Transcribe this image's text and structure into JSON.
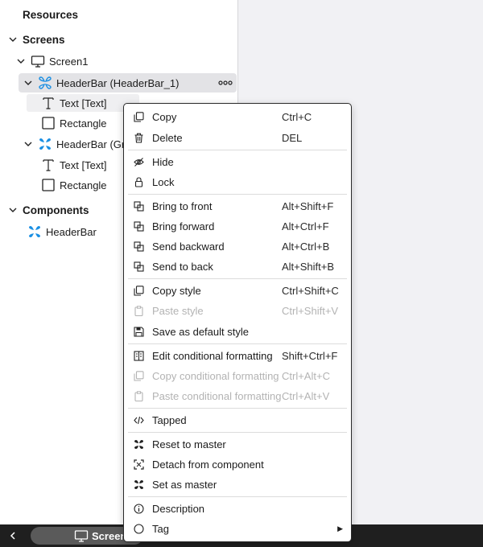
{
  "tree": {
    "resources_label": "Resources",
    "screens_label": "Screens",
    "screen1_label": "Screen1",
    "headerbar1_label": "HeaderBar (HeaderBar_1)",
    "text1_label": "Text [Text]",
    "rect1_label": "Rectangle",
    "headerbar2_label": "HeaderBar (Gre",
    "text2_label": "Text [Text]",
    "rect2_label": "Rectangle",
    "components_label": "Components",
    "component_headerbar_label": "HeaderBar"
  },
  "bottom_bar": {
    "screen_tab_label": "Screen"
  },
  "context_menu": {
    "copy": {
      "label": "Copy",
      "shortcut": "Ctrl+C"
    },
    "delete": {
      "label": "Delete",
      "shortcut": "DEL"
    },
    "hide": {
      "label": "Hide"
    },
    "lock": {
      "label": "Lock"
    },
    "bring_to_front": {
      "label": "Bring to front",
      "shortcut": "Alt+Shift+F"
    },
    "bring_forward": {
      "label": "Bring forward",
      "shortcut": "Alt+Ctrl+F"
    },
    "send_backward": {
      "label": "Send backward",
      "shortcut": "Alt+Ctrl+B"
    },
    "send_to_back": {
      "label": "Send to back",
      "shortcut": "Alt+Shift+B"
    },
    "copy_style": {
      "label": "Copy style",
      "shortcut": "Ctrl+Shift+C"
    },
    "paste_style": {
      "label": "Paste style",
      "shortcut": "Ctrl+Shift+V",
      "disabled": true
    },
    "save_default_style": {
      "label": "Save as default style"
    },
    "edit_cond": {
      "label": "Edit conditional formatting",
      "shortcut": "Shift+Ctrl+F"
    },
    "copy_cond": {
      "label": "Copy conditional formatting",
      "shortcut": "Ctrl+Alt+C",
      "disabled": true
    },
    "paste_cond": {
      "label": "Paste conditional formatting",
      "shortcut": "Ctrl+Alt+V",
      "disabled": true
    },
    "tapped": {
      "label": "Tapped"
    },
    "reset_master": {
      "label": "Reset to master"
    },
    "detach": {
      "label": "Detach from component"
    },
    "set_master": {
      "label": "Set as master"
    },
    "description": {
      "label": "Description"
    },
    "tag": {
      "label": "Tag"
    }
  },
  "colors": {
    "component_blue": "#1a8fe3",
    "dark_bar": "#1f1f1f"
  }
}
